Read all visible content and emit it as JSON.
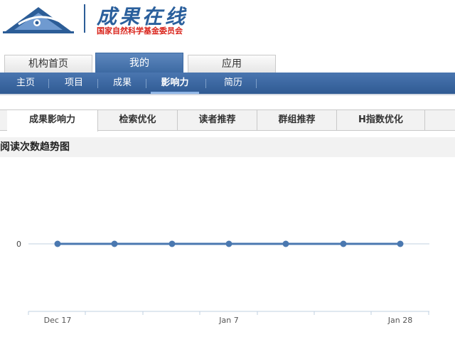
{
  "header": {
    "title": "成果在线",
    "subtitle": "国家自然科学基金委员会"
  },
  "main_tabs": [
    {
      "label": "机构首页",
      "active": false
    },
    {
      "label": "我的",
      "active": true
    },
    {
      "label": "应用",
      "active": false
    }
  ],
  "sub_nav": [
    {
      "label": "主页",
      "active": false
    },
    {
      "label": "项目",
      "active": false
    },
    {
      "label": "成果",
      "active": false
    },
    {
      "label": "影响力",
      "active": true
    },
    {
      "label": "简历",
      "active": false
    }
  ],
  "content_tabs": [
    {
      "label": "成果影响力",
      "active": true
    },
    {
      "label": "检索优化",
      "active": false
    },
    {
      "label": "读者推荐",
      "active": false
    },
    {
      "label": "群组推荐",
      "active": false
    },
    {
      "label": "H指数优化",
      "active": false
    }
  ],
  "section": {
    "title": "阅读次数趋势图"
  },
  "colors": {
    "brand_blue": "#3d6aa3",
    "series_blue": "#4a78b0",
    "logo_red": "#d9231a"
  },
  "chart_data": {
    "type": "line",
    "x": [
      "Dec 17",
      "Dec 24",
      "Dec 31",
      "Jan 7",
      "Jan 14",
      "Jan 21",
      "Jan 28"
    ],
    "x_tick_labels": [
      "Dec 17",
      "Jan 7",
      "Jan 28"
    ],
    "series": [
      {
        "values": [
          0,
          0,
          0,
          0,
          0,
          0,
          0
        ]
      }
    ],
    "y_tick_labels": [
      "0"
    ],
    "title": "",
    "xlabel": "",
    "ylabel": "",
    "ylim": [
      -1,
      1
    ],
    "grid": true,
    "legend": "none"
  }
}
